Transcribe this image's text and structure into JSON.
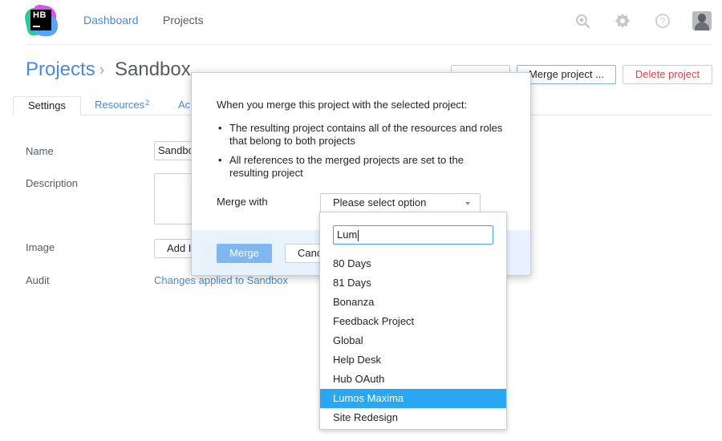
{
  "app": {
    "logo_text": "HB",
    "nav": {
      "dashboard": "Dashboard",
      "projects": "Projects"
    }
  },
  "header": {
    "crumb_root": "Projects",
    "separator": "›",
    "crumb_current": "Sandbox",
    "buttons": {
      "hidden": "",
      "merge_project": "Merge project ...",
      "delete_project": "Delete project"
    }
  },
  "tabs": {
    "settings": "Settings",
    "resources": "Resources",
    "resources_count": "2",
    "access": "Ac"
  },
  "form": {
    "name_label": "Name",
    "name_value": "Sandbox",
    "description_label": "Description",
    "image_label": "Image",
    "add_image_label": "Add Image",
    "audit_label": "Audit",
    "audit_link": "Changes applied to Sandbox"
  },
  "modal": {
    "intro": "When you merge this project with the selected project:",
    "bullets": [
      "The resulting project contains all of the resources and roles that belong to both projects",
      "All references to the merged projects are set to the resulting project"
    ],
    "merge_with_label": "Merge with",
    "select_placeholder": "Please select option",
    "merge_button": "Merge",
    "cancel_button": "Cancel"
  },
  "dropdown": {
    "filter_value": "Lum",
    "options": [
      "80 Days",
      "81 Days",
      "Bonanza",
      "Feedback Project",
      "Global",
      "Help Desk",
      "Hub OAuth",
      "Lumos Maxima",
      "Site Redesign"
    ],
    "selected": "Lumos Maxima"
  },
  "colors": {
    "link": "#4a8ad8",
    "danger": "#d14848",
    "primary_button": "#7fb7ee",
    "selected_option": "#2aa7f2",
    "modal_footer": "#e8f2fd"
  }
}
